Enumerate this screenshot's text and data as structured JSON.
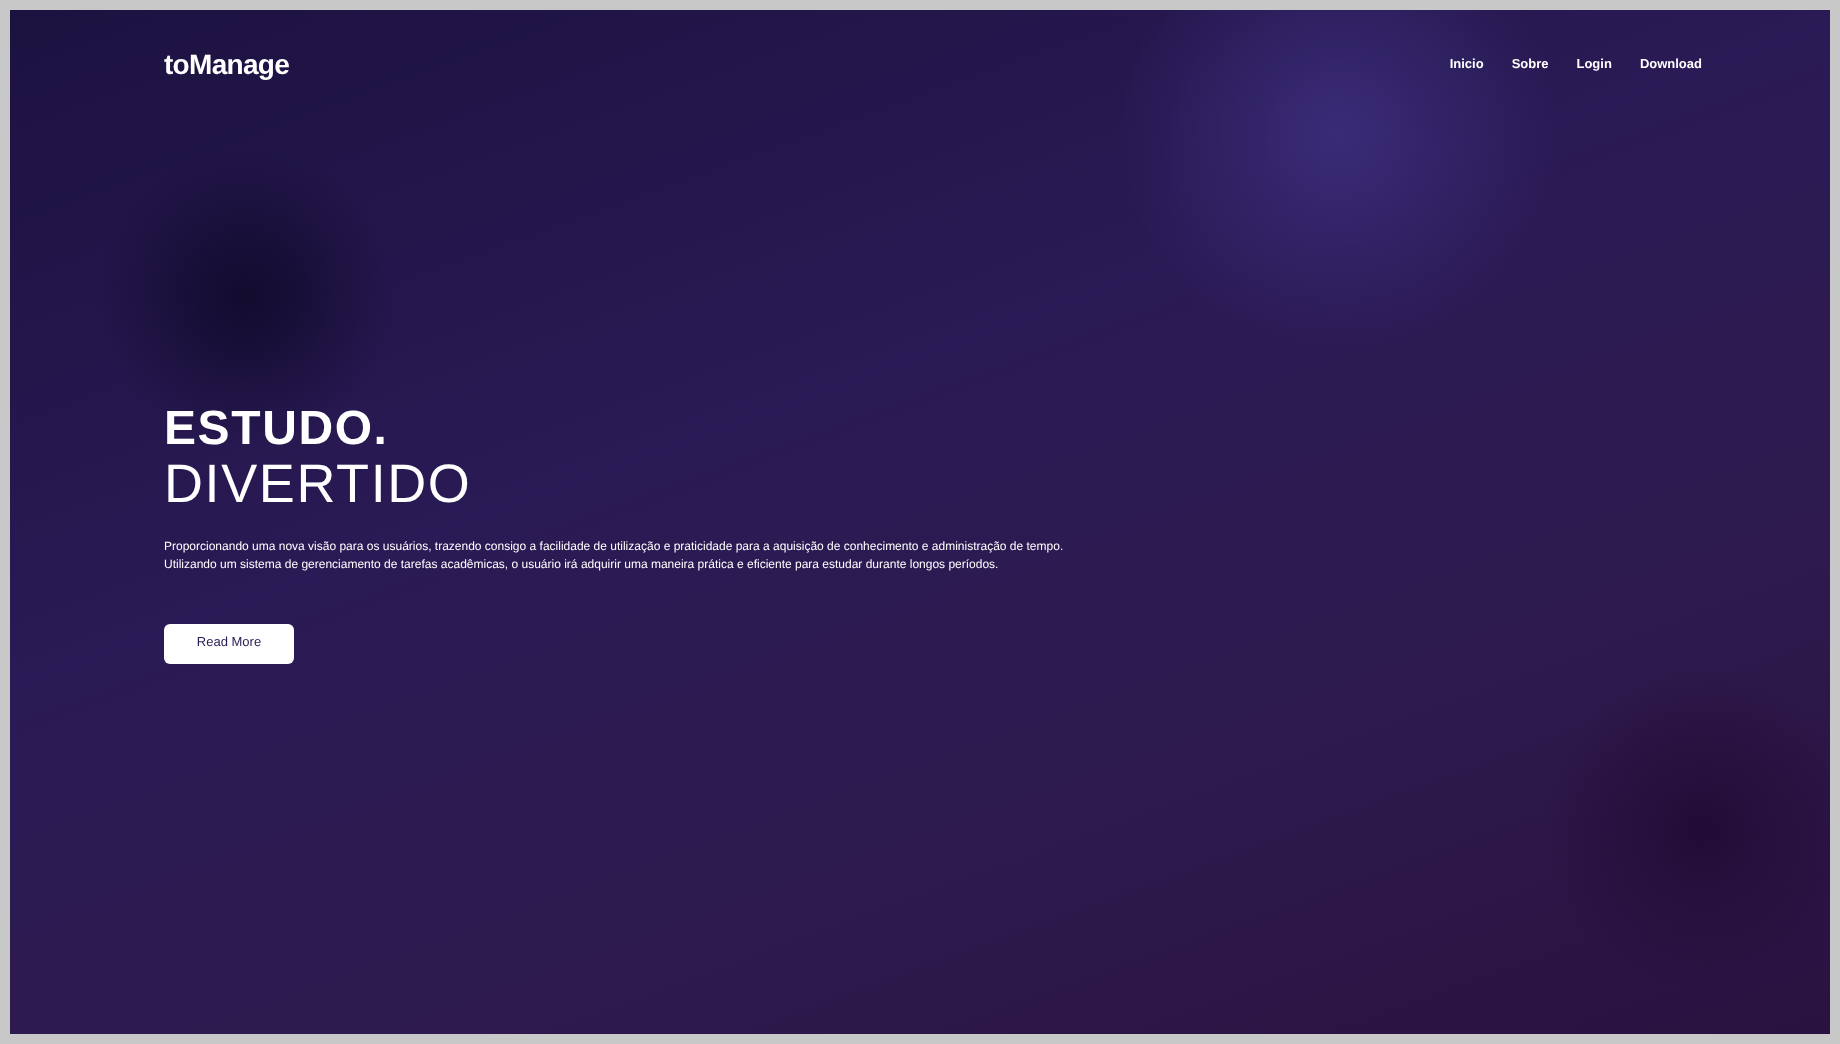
{
  "logo": "toManage",
  "nav": [
    {
      "label": "Inicio"
    },
    {
      "label": "Sobre"
    },
    {
      "label": "Login"
    },
    {
      "label": "Download"
    }
  ],
  "hero": {
    "title_lines": [
      "ESTUDO.",
      "DIVERTIDO"
    ],
    "description_lines": [
      "Proporcionando uma nova visão para os usuários, trazendo consigo a facilidade de utilização e praticidade para a aquisição de conhecimento e administração de tempo.",
      "Utilizando um sistema de gerenciamento de tarefas acadêmicas, o usuário irá adquirir uma maneira prática e eficiente para estudar durante longos períodos."
    ],
    "button": "Read More"
  }
}
